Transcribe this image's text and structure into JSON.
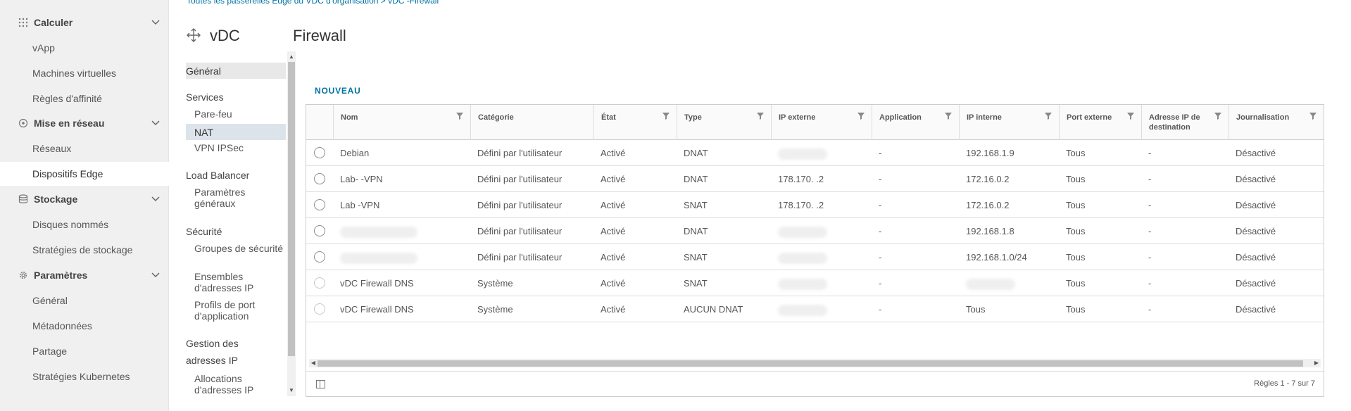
{
  "breadcrumb": "Toutes les passerelles Edge du VDC d'organisation  >  vDC      -Firewall",
  "sidebar": {
    "groups": [
      {
        "label": "Calculer",
        "icon": "compute-grid-icon",
        "items": [
          "vApp",
          "Machines virtuelles",
          "Règles d'affinité"
        ]
      },
      {
        "label": "Mise en réseau",
        "icon": "network-icon",
        "items": [
          "Réseaux",
          "Dispositifs Edge"
        ]
      },
      {
        "label": "Stockage",
        "icon": "storage-icon",
        "items": [
          "Disques nommés",
          "Stratégies de stockage"
        ]
      },
      {
        "label": "Paramètres",
        "icon": "gear-icon",
        "items": [
          "Général",
          "Métadonnées",
          "Partage",
          "Stratégies Kubernetes"
        ]
      }
    ],
    "active_item": "Dispositifs Edge"
  },
  "vdc_header": {
    "title": "vDC",
    "icon": "move-arrows-icon"
  },
  "page_title": "Firewall",
  "subnav": {
    "general": "Général",
    "services": {
      "label": "Services",
      "items": [
        "Pare-feu",
        "NAT",
        "VPN IPSec"
      ]
    },
    "load_balancer": {
      "label": "Load Balancer",
      "items": [
        "Paramètres généraux"
      ]
    },
    "security": {
      "label": "Sécurité",
      "items": [
        "Groupes de sécurité",
        "Ensembles d'adresses IP",
        "Profils de port d'application"
      ]
    },
    "ip_management": {
      "label": "Gestion des adresses IP",
      "items": [
        "Allocations d'adresses IP"
      ]
    },
    "selected": "NAT"
  },
  "toolbar": {
    "new_label": "NOUVEAU"
  },
  "table": {
    "columns": [
      "Nom",
      "Catégorie",
      "État",
      "Type",
      "IP externe",
      "Application",
      "IP interne",
      "Port externe",
      "Adresse IP de destination",
      "Journalisation"
    ],
    "rows": [
      {
        "name": "Debian",
        "category": "Défini par l'utilisateur",
        "state": "Activé",
        "type": "DNAT",
        "ext_ip": "",
        "app": "-",
        "int_ip": "192.168.1.9",
        "ext_port": "Tous",
        "dest_ip": "-",
        "logging": "Désactivé",
        "selectable": true
      },
      {
        "name": "Lab-       -VPN",
        "category": "Défini par l'utilisateur",
        "state": "Activé",
        "type": "DNAT",
        "ext_ip": "178.170.    .2",
        "app": "-",
        "int_ip": "172.16.0.2",
        "ext_port": "Tous",
        "dest_ip": "-",
        "logging": "Désactivé",
        "selectable": true
      },
      {
        "name": "Lab       -VPN",
        "category": "Défini par l'utilisateur",
        "state": "Activé",
        "type": "SNAT",
        "ext_ip": "178.170.    .2",
        "app": "-",
        "int_ip": "172.16.0.2",
        "ext_port": "Tous",
        "dest_ip": "-",
        "logging": "Désactivé",
        "selectable": true
      },
      {
        "name": "",
        "category": "Défini par l'utilisateur",
        "state": "Activé",
        "type": "DNAT",
        "ext_ip": "",
        "app": "-",
        "int_ip": "192.168.1.8",
        "ext_port": "Tous",
        "dest_ip": "-",
        "logging": "Désactivé",
        "selectable": true
      },
      {
        "name": "",
        "category": "Défini par l'utilisateur",
        "state": "Activé",
        "type": "SNAT",
        "ext_ip": "",
        "app": "-",
        "int_ip": "192.168.1.0/24",
        "ext_port": "Tous",
        "dest_ip": "-",
        "logging": "Désactivé",
        "selectable": true
      },
      {
        "name": "vDC          Firewall DNS",
        "category": "Système",
        "state": "Activé",
        "type": "SNAT",
        "ext_ip": "",
        "app": "-",
        "int_ip": "",
        "ext_port": "Tous",
        "dest_ip": "-",
        "logging": "Désactivé",
        "selectable": false
      },
      {
        "name": "vDC          Firewall DNS",
        "category": "Système",
        "state": "Activé",
        "type": "AUCUN DNAT",
        "ext_ip": "",
        "app": "-",
        "int_ip": "Tous",
        "ext_port": "Tous",
        "dest_ip": "-",
        "logging": "Désactivé",
        "selectable": false
      }
    ]
  },
  "pagination": "Règles 1 - 7 sur 7",
  "colors": {
    "link": "#0072a3",
    "sidebar_bg": "#f0f0f0",
    "selected_bg": "#dde3ea"
  }
}
